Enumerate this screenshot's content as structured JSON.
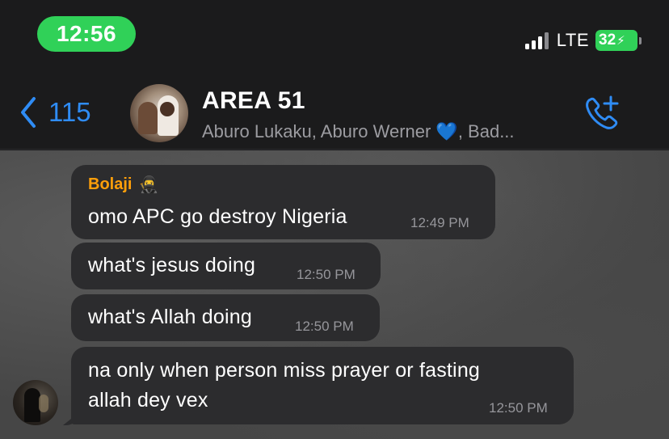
{
  "status_bar": {
    "time": "12:56",
    "network": "LTE",
    "battery_level": "32",
    "battery_fraction": 0.32,
    "charging_symbol": "⚡"
  },
  "nav": {
    "back_count": "115",
    "group_name": "AREA 51",
    "members_preview": "Aburo Lukaku, Aburo Werner 💙, Bad...",
    "call_icon": "phone-plus-icon"
  },
  "messages": [
    {
      "sender": "Bolaji",
      "sender_emoji": "🥷",
      "text": "omo APC go destroy Nigeria",
      "time": "12:49 PM"
    },
    {
      "text": "what's jesus doing",
      "time": "12:50 PM"
    },
    {
      "text": "what's Allah doing",
      "time": "12:50 PM"
    },
    {
      "text_line1": "na only when person miss prayer or fasting",
      "text_line2": "allah dey vex",
      "time": "12:50 PM"
    }
  ],
  "colors": {
    "accent": "#2f8cf5",
    "sender_name": "#ff9f0a",
    "time_pill": "#30d158",
    "bubble": "#2c2c2e"
  }
}
